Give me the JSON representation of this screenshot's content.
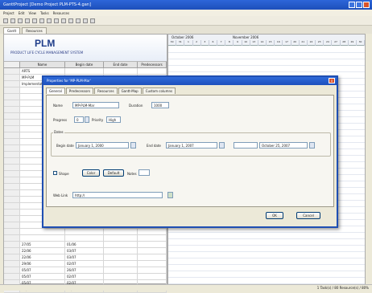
{
  "window": {
    "title": "GanttProject [Demo Project PLM-PTS-4.gan]"
  },
  "menu": [
    "Project",
    "Edit",
    "View",
    "Tasks",
    "Resources"
  ],
  "tabs": [
    "Gantt",
    "Resources"
  ],
  "banner": {
    "logo": "PLM",
    "subtitle": "PRODUCT LIFE CYCLE MANAGEMENT SYSTEM"
  },
  "grid": {
    "headers": [
      "",
      "Name",
      "Begin date",
      "End date",
      "Predecessors"
    ],
    "rows": [
      [
        "",
        "ARTS",
        "",
        "",
        ""
      ],
      [
        "",
        "MP-PLM",
        "",
        "",
        ""
      ],
      [
        "",
        "Implementation",
        "",
        "",
        ""
      ],
      [
        "",
        "",
        "",
        "",
        ""
      ],
      [
        "",
        "",
        "",
        "",
        ""
      ],
      [
        "",
        "",
        "",
        "",
        ""
      ],
      [
        "",
        "",
        "",
        "",
        ""
      ],
      [
        "",
        "",
        "",
        "",
        ""
      ],
      [
        "",
        "",
        "",
        "",
        ""
      ],
      [
        "",
        "",
        "",
        "",
        ""
      ],
      [
        "",
        "",
        "",
        "",
        ""
      ],
      [
        "",
        "",
        "",
        "",
        ""
      ],
      [
        "",
        "",
        "",
        "",
        ""
      ],
      [
        "",
        "",
        "",
        "",
        ""
      ],
      [
        "",
        "",
        "",
        "",
        ""
      ],
      [
        "",
        "",
        "",
        "",
        ""
      ],
      [
        "",
        "",
        "",
        "",
        ""
      ],
      [
        "",
        "",
        "",
        "",
        ""
      ],
      [
        "",
        "",
        "",
        "",
        ""
      ],
      [
        "",
        "",
        "",
        "",
        ""
      ],
      [
        "",
        "",
        "",
        "",
        ""
      ],
      [
        "",
        "",
        "",
        "",
        ""
      ],
      [
        "",
        "",
        "",
        "",
        ""
      ],
      [
        "",
        "",
        "",
        "",
        ""
      ],
      [
        "",
        "",
        "",
        "",
        ""
      ],
      [
        "",
        "",
        "",
        "",
        ""
      ],
      [
        "",
        "",
        "",
        "",
        ""
      ],
      [
        "",
        "27/05",
        "01/06",
        "",
        ""
      ],
      [
        "",
        "22/06",
        "03/07",
        "",
        ""
      ],
      [
        "",
        "22/06",
        "03/07",
        "",
        ""
      ],
      [
        "",
        "29/06",
        "02/07",
        "",
        ""
      ],
      [
        "",
        "05/07",
        "26/07",
        "",
        ""
      ],
      [
        "",
        "05/07",
        "02/07",
        "",
        ""
      ],
      [
        "",
        "05/07",
        "02/07",
        "",
        ""
      ],
      [
        "",
        "01/07",
        "02/08",
        "",
        ""
      ]
    ]
  },
  "gantt": {
    "months": [
      "October 2006",
      "November 2006"
    ],
    "days": [
      "30",
      "31",
      "1",
      "2",
      "3",
      "6",
      "7",
      "8",
      "9",
      "10",
      "13",
      "14",
      "15",
      "16",
      "17",
      "20",
      "21",
      "22",
      "23",
      "24",
      "27",
      "28",
      "29",
      "30"
    ]
  },
  "dialog": {
    "title": "Properties for 'MP-PLM-Mar'",
    "close": "x",
    "tabs": [
      "General",
      "Predecessors",
      "Resources",
      "Gantt-Map",
      "Custom columns"
    ],
    "name_label": "Name",
    "name_value": "MP-PLM-Mar",
    "duration_label": "Duration",
    "duration_value": "1000",
    "progress_label": "Progress",
    "progress_value": "0",
    "priority_label": "Priority",
    "priority_value": "High",
    "dates_label": "Dates",
    "begin_label": "Begin date",
    "begin_value": "January 1, 2000",
    "end_label": "End date",
    "end_value": "January 1, 2007",
    "third_label": "",
    "third_value": "October 25, 2007",
    "shape_label": "Shape",
    "color_label": "Color",
    "default_label": "Default",
    "notes_label": "Notes",
    "web_label": "Web Link",
    "web_value": "http://",
    "ok": "OK",
    "cancel": "Cancel"
  },
  "status": "1 Task(s) / 80 Resource(s) / 80%"
}
